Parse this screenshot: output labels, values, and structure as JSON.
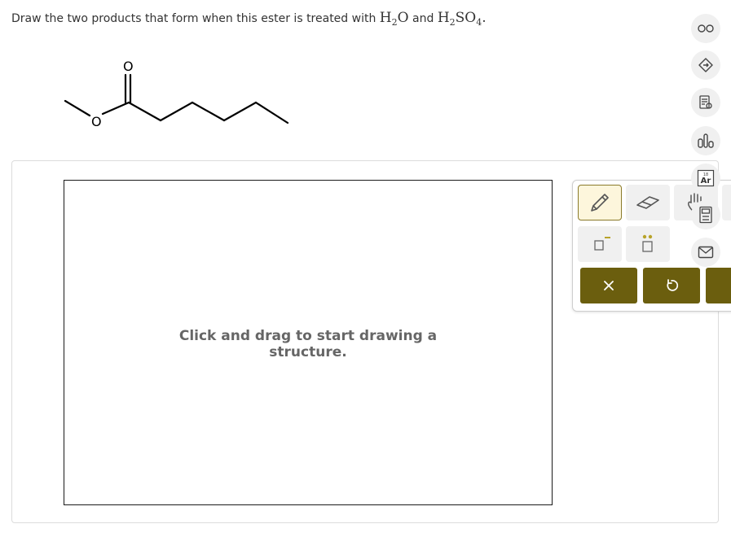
{
  "question": {
    "text": "Draw the two products that form when this ester is treated with",
    "reagent1_prefix": "H",
    "reagent1_sub": "2",
    "reagent1_suffix": "O",
    "conjunction": "and",
    "reagent2_prefix": "H",
    "reagent2_sub": "2",
    "reagent2_mid": "SO",
    "reagent2_sub2": "4",
    "end": "."
  },
  "molecule": {
    "carbonyl_oxygen": "O",
    "ester_oxygen": "O"
  },
  "canvas": {
    "hint_line1": "Click and drag to start drawing a",
    "hint_line2": "structure."
  },
  "toolbox": {
    "tools": [
      "pencil-tool",
      "eraser-tool",
      "hand-tool",
      "charge-tool",
      "lone-pair-tool"
    ],
    "actions": [
      "clear-button",
      "undo-button",
      "redo-button"
    ]
  },
  "sidebar": {
    "periodic_label": "Ar",
    "periodic_number": "18"
  },
  "colors": {
    "accent": "#6b5e0e",
    "active_tool_bg": "#fdf6dc",
    "tool_bg": "#f0f0f0",
    "hint_text": "#666666"
  }
}
